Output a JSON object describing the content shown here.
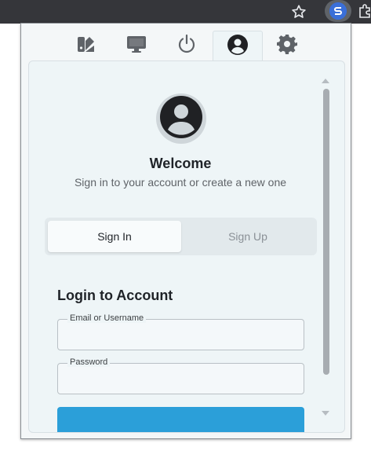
{
  "tabs": [
    {
      "icon": "palette-icon"
    },
    {
      "icon": "monitor-icon"
    },
    {
      "icon": "power-icon"
    },
    {
      "icon": "user-circle-icon",
      "active": true
    },
    {
      "icon": "gear-icon"
    }
  ],
  "header": {
    "welcome": "Welcome",
    "subtitle": "Sign in to your account or create a new one"
  },
  "segment": {
    "sign_in": "Sign In",
    "sign_up": "Sign Up",
    "selected": "Sign In"
  },
  "form": {
    "title": "Login to Account",
    "email_label": "Email or Username",
    "email_value": "",
    "password_label": "Password",
    "password_value": ""
  },
  "colors": {
    "accent": "#2b9fd9",
    "toolbar": "#35363a"
  }
}
